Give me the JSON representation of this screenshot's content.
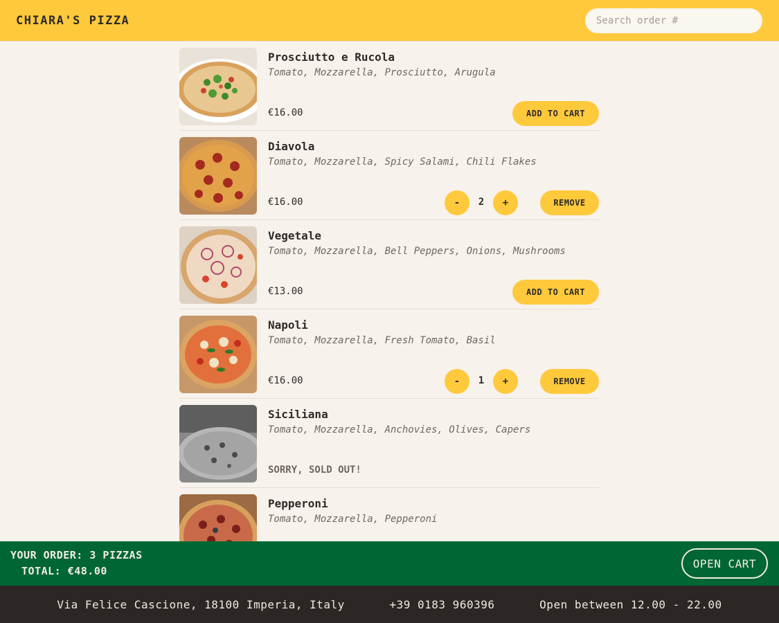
{
  "header": {
    "brand": "CHIARA'S PIZZA",
    "search_placeholder": "Search order #"
  },
  "menu": [
    {
      "name": "Prosciutto e Rucola",
      "ingredients": "Tomato, Mozzarella, Prosciutto, Arugula",
      "price": "€16.00",
      "state": "add",
      "button_label": "ADD TO CART",
      "image": "pizza-arugula-image"
    },
    {
      "name": "Diavola",
      "ingredients": "Tomato, Mozzarella, Spicy Salami, Chili Flakes",
      "price": "€16.00",
      "state": "in_cart",
      "quantity": "2",
      "minus_label": "-",
      "plus_label": "+",
      "button_label": "REMOVE",
      "image": "pizza-salami-image"
    },
    {
      "name": "Vegetale",
      "ingredients": "Tomato, Mozzarella, Bell Peppers, Onions, Mushrooms",
      "price": "€13.00",
      "state": "add",
      "button_label": "ADD TO CART",
      "image": "pizza-vegetable-image"
    },
    {
      "name": "Napoli",
      "ingredients": "Tomato, Mozzarella, Fresh Tomato, Basil",
      "price": "€16.00",
      "state": "in_cart",
      "quantity": "1",
      "minus_label": "-",
      "plus_label": "+",
      "button_label": "REMOVE",
      "image": "pizza-napoli-image"
    },
    {
      "name": "Siciliana",
      "ingredients": "Tomato, Mozzarella, Anchovies, Olives, Capers",
      "price": "SORRY, SOLD OUT!",
      "state": "sold_out",
      "image": "pizza-siciliana-image"
    },
    {
      "name": "Pepperoni",
      "ingredients": "Tomato, Mozzarella, Pepperoni",
      "price": "",
      "state": "add",
      "image": "pizza-pepperoni-image"
    }
  ],
  "order_bar": {
    "summary": "YOUR ORDER: 3 PIZZAS",
    "total": "TOTAL: €48.00",
    "open_cart_label": "OPEN CART"
  },
  "footer": {
    "address": "Via Felice Cascione, 18100 Imperia, Italy",
    "phone": "+39 0183 960396",
    "hours": "Open between 12.00 - 22.00"
  },
  "colors": {
    "accent": "#ffc93c",
    "order_bar": "#006633",
    "footer": "#2c2725",
    "background": "#f7f2ec"
  }
}
